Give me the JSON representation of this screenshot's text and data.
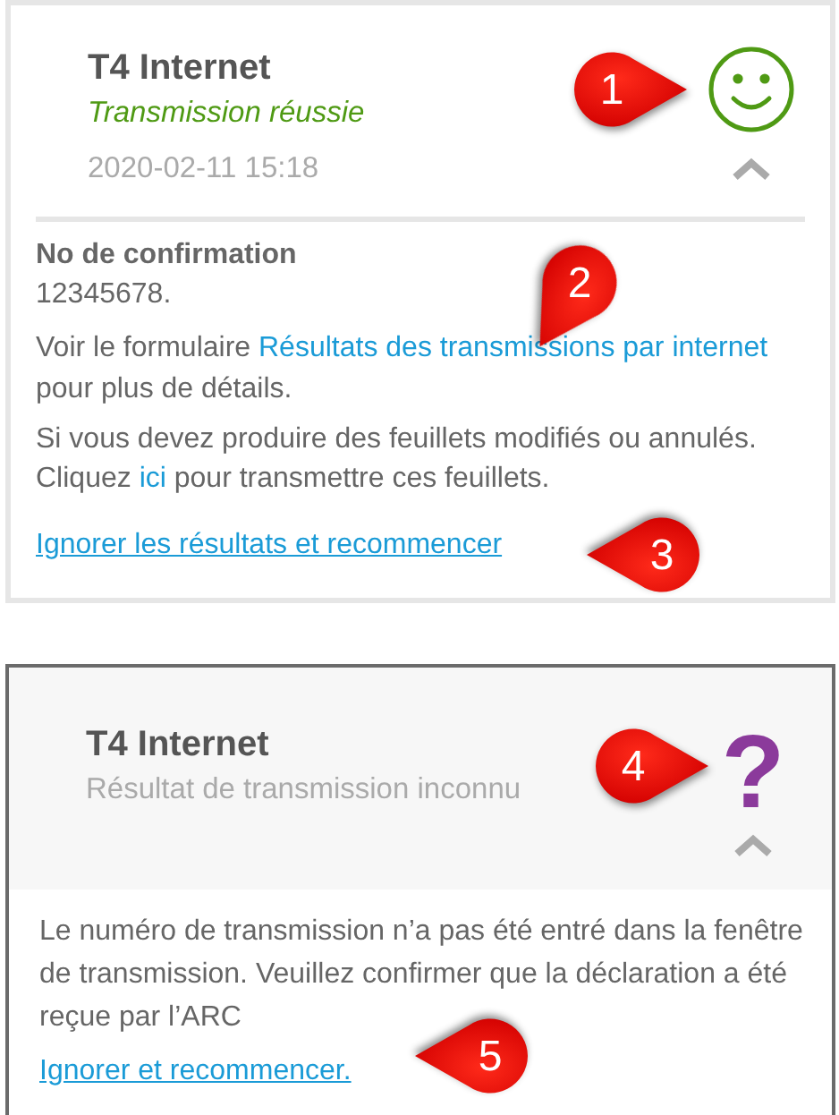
{
  "cards": [
    {
      "selected": false,
      "kind": "success",
      "title": "T4 Internet",
      "subtitle": "Transmission réussie",
      "timestamp": "2020-02-11 15:18",
      "expanded": true,
      "confirmation_label": "No de confirmation",
      "confirmation_number": "12345678.",
      "paragraphs": [
        [
          {
            "text": "Voir le formulaire "
          },
          {
            "text": "Résultats des transmissions par internet",
            "kind": "link"
          },
          {
            "text": " pour plus de détails."
          }
        ],
        [
          {
            "text": "Si vous devez produire des feuillets modifiés ou annulés. Cliquez "
          },
          {
            "text": "ici",
            "kind": "link"
          },
          {
            "text": " pour transmettre ces feuillets."
          }
        ]
      ],
      "action_link": "Ignorer les résultats et recommencer"
    },
    {
      "selected": true,
      "kind": "unknown",
      "icon_glyph": "?",
      "title": "T4 Internet",
      "subtitle": "Résultat de transmission inconnu",
      "expanded": true,
      "paragraphs": [
        [
          {
            "text": "Le numéro de transmission n’a pas été entré dans la fenêtre de transmission. Veuillez confirmer que la déclaration a été reçue par l’ARC"
          }
        ]
      ],
      "action_link": "Ignorer et recommencer."
    }
  ],
  "callouts": [
    {
      "number": "1"
    },
    {
      "number": "2"
    },
    {
      "number": "3"
    },
    {
      "number": "4"
    },
    {
      "number": "5"
    }
  ]
}
